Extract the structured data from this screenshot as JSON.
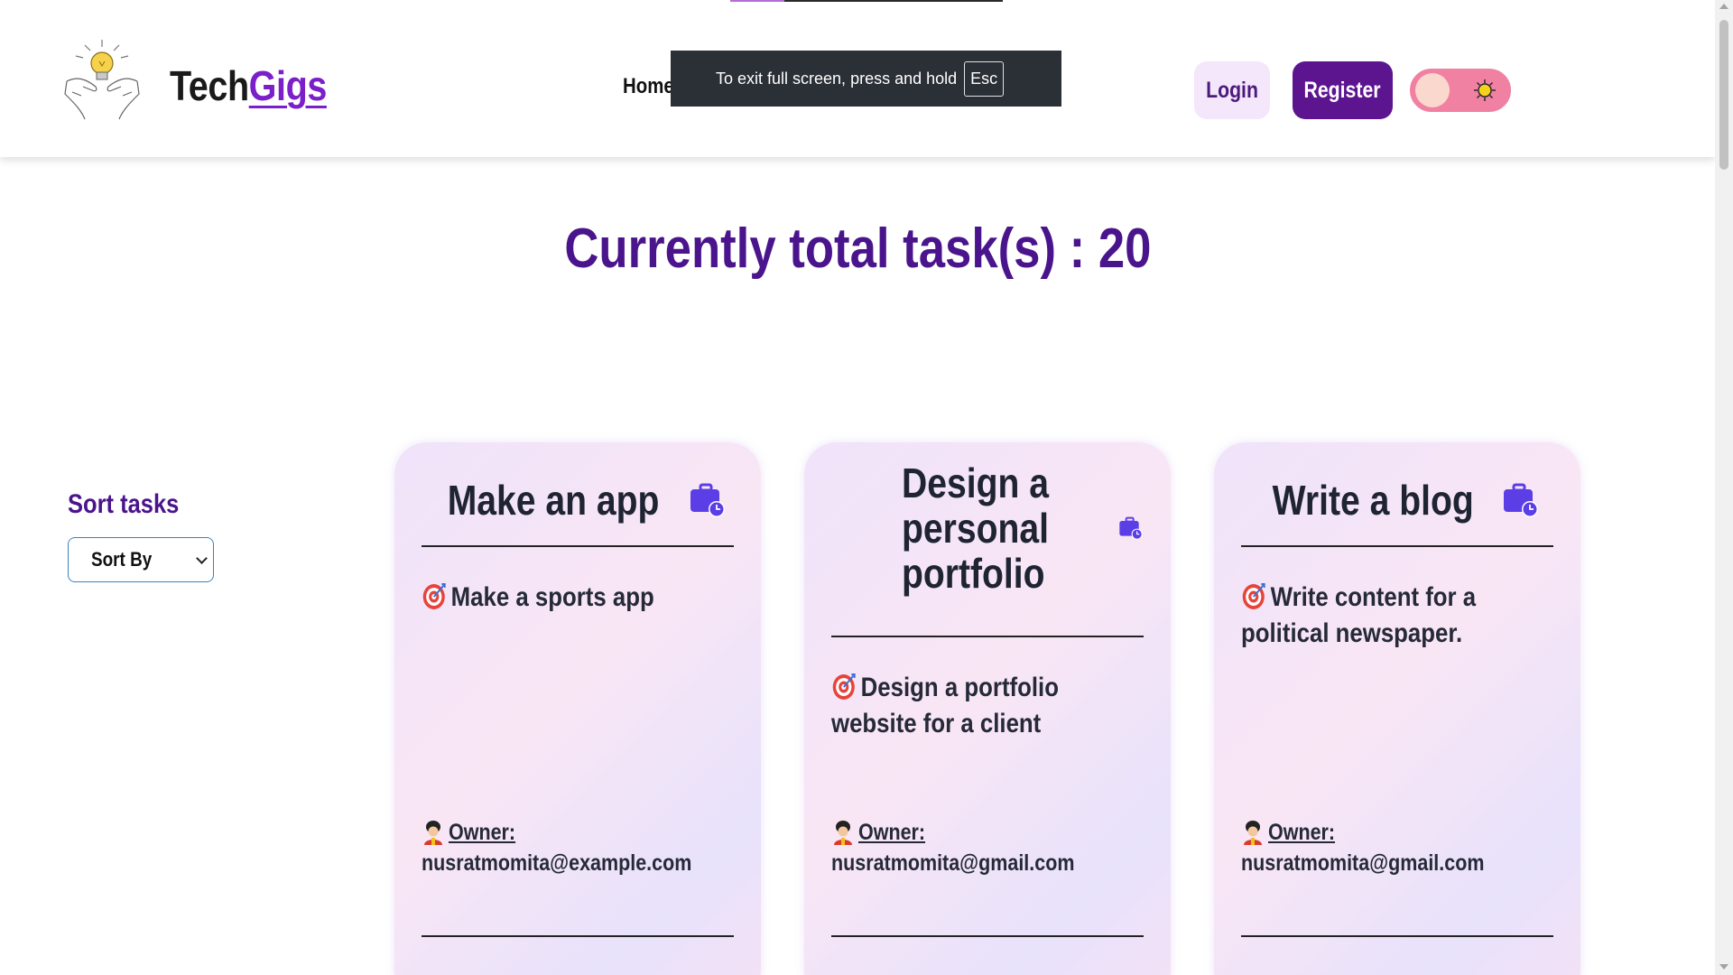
{
  "header": {
    "brand_part1": "Tech",
    "brand_part2": "Gigs",
    "nav_home": "Home",
    "login_label": "Login",
    "register_label": "Register"
  },
  "fullscreen_toast": {
    "message": "To exit full screen, press and hold",
    "key": "Esc"
  },
  "main": {
    "total_text": "Currently total task(s) : 20"
  },
  "sidebar": {
    "sort_title": "Sort tasks",
    "sort_select_value": "Sort By"
  },
  "cards": [
    {
      "title": "Make an app",
      "description": "Make a sports app",
      "owner_label": "Owner:",
      "owner_email": "nusratmomita@example.com"
    },
    {
      "title_lines": [
        "Design a",
        "personal",
        "portfolio"
      ],
      "description_lines": [
        "Design a portfolio",
        "website for a client"
      ],
      "owner_label": "Owner:",
      "owner_email": "nusratmomita@gmail.com"
    },
    {
      "title": "Write a blog",
      "description_lines": [
        "Write content for a",
        "political newspaper."
      ],
      "owner_label": "Owner:",
      "owner_email": "nusratmomita@gmail.com"
    }
  ],
  "colors": {
    "brand_accent": "#7a1fc9",
    "heading_purple": "#4a148c",
    "register_bg": "#5c148f",
    "login_bg": "#f4e6fb",
    "toggle_bg": "#f081a3"
  },
  "icons": [
    "lightbulb-hands-logo-icon",
    "sun-icon",
    "briefcase-clock-icon",
    "target-icon",
    "guard-icon",
    "chevron-down-icon"
  ]
}
